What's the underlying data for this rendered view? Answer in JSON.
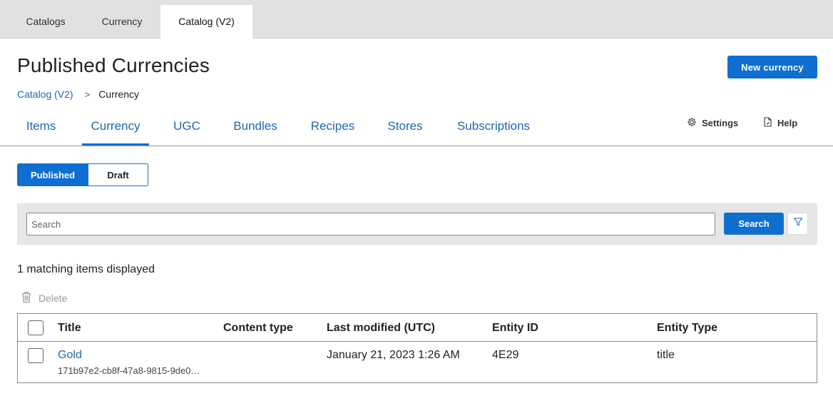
{
  "top_tabs": [
    "Catalogs",
    "Currency",
    "Catalog (V2)"
  ],
  "page": {
    "title": "Published Currencies",
    "new_button": "New currency"
  },
  "breadcrumb": {
    "parent": "Catalog (V2)",
    "separator": ">",
    "current": "Currency"
  },
  "nav": {
    "tabs": [
      "Items",
      "Currency",
      "UGC",
      "Bundles",
      "Recipes",
      "Stores",
      "Subscriptions"
    ],
    "active": "Currency",
    "settings": "Settings",
    "help": "Help"
  },
  "status_toggle": {
    "published": "Published",
    "draft": "Draft",
    "selected": "Published"
  },
  "search": {
    "placeholder": "Search",
    "button": "Search"
  },
  "results": {
    "count_text": "1 matching items displayed",
    "delete_label": "Delete"
  },
  "table": {
    "columns": [
      "Title",
      "Content type",
      "Last modified (UTC)",
      "Entity ID",
      "Entity Type"
    ],
    "rows": [
      {
        "title": "Gold",
        "id_preview": "171b97e2-cb8f-47a8-9815-9de0…",
        "content_type": "",
        "last_modified": "January 21, 2023 1:26 AM",
        "entity_id": "4E29",
        "entity_type": "title"
      }
    ]
  },
  "colors": {
    "accent": "#0e6fd1",
    "link": "#1c67b0",
    "top_bar": "#e1e1e1",
    "search_panel": "#e6e6e6"
  },
  "icons": [
    "gear-icon",
    "help-icon",
    "trash-icon",
    "filter-icon"
  ]
}
